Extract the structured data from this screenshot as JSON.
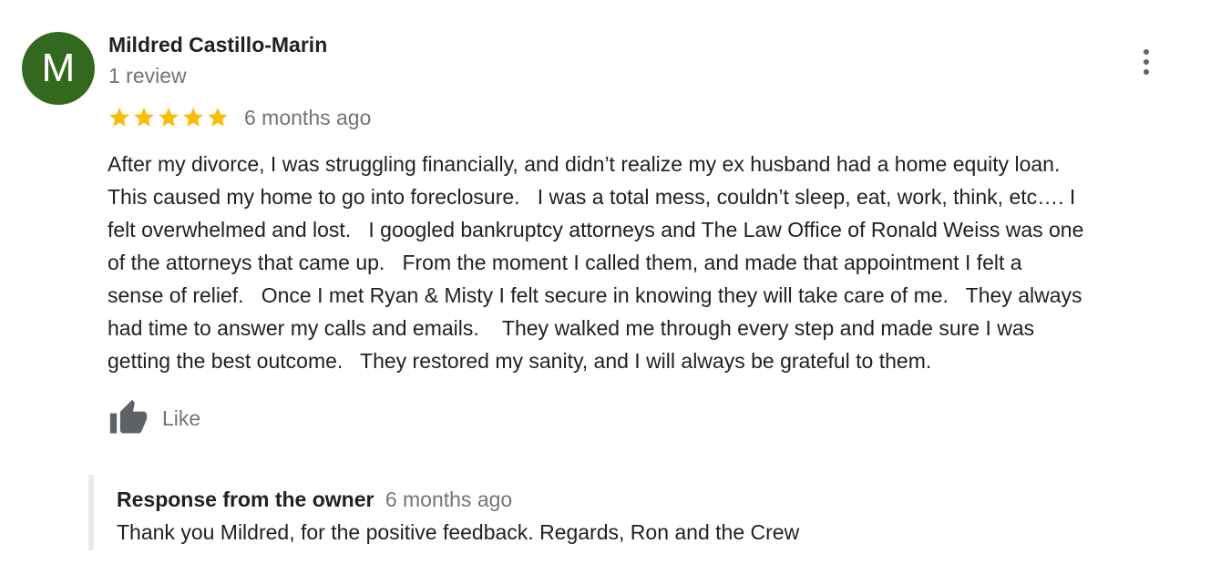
{
  "review": {
    "avatar_initial": "M",
    "avatar_color": "#33691e",
    "reviewer_name": "Mildred Castillo-Marin",
    "review_count": "1 review",
    "rating": 5,
    "rating_max": 5,
    "star_color": "#fbbc04",
    "date": "6 months ago",
    "text": "After my divorce, I was struggling financially, and didn’t realize my ex husband had a home equity loan.\nThis caused my home to go into foreclosure.   I was a total mess, couldn’t sleep, eat, work, think, etc…. I\nfelt overwhelmed and lost.   I googled bankruptcy attorneys and The Law Office of Ronald Weiss was one\nof the attorneys that came up.   From the moment I called them, and made that appointment I felt a\nsense of relief.   Once I met Ryan & Misty I felt secure in knowing they will take care of me.   They always\nhad time to answer my calls and emails.    They walked me through every step and made sure I was\ngetting the best outcome.   They restored my sanity, and I will always be grateful to them.",
    "like_label": "Like",
    "like_icon": "thumbs-up-icon",
    "menu_icon": "more-vertical-icon"
  },
  "owner_response": {
    "title": "Response from the owner",
    "date": "6 months ago",
    "text": "Thank you Mildred, for the positive feedback. Regards, Ron and the Crew"
  }
}
